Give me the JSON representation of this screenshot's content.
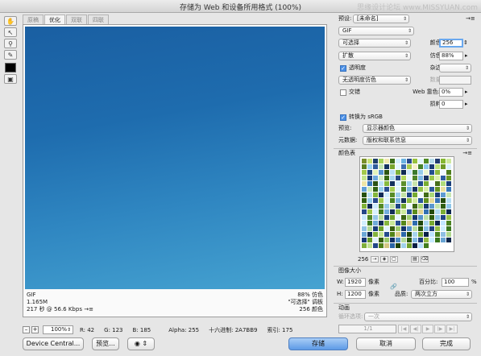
{
  "window": {
    "title": "存储为 Web 和设备所用格式 (100%)",
    "watermark": "思缘设计论坛 www.MISSYUAN.com"
  },
  "tools": [
    "hand-tool",
    "slice-select-tool",
    "zoom-tool",
    "eyedropper-tool"
  ],
  "tabs": [
    "原稿",
    "优化",
    "双联",
    "四联"
  ],
  "active_tab": "优化",
  "canvas_info": {
    "format": "GIF",
    "size": "1.165M",
    "time": "217 秒 @ 56.6 Kbps",
    "menu": "→≡",
    "dither_pct": "88% 仿色",
    "palette": "\"可选择\" 调板",
    "colors": "256 颜色"
  },
  "status": {
    "zoom_minus": "–",
    "zoom_plus": "+",
    "zoom": "100%",
    "r": "R: 42",
    "g": "G: 123",
    "b": "B: 185",
    "alpha": "Alpha: 255",
    "hex": "十六进制: 2A7BB9",
    "index": "索引: 175"
  },
  "buttons": {
    "device_central": "Device Central...",
    "preview": "预览...",
    "save": "存储",
    "cancel": "取消",
    "done": "完成"
  },
  "settings": {
    "preset_label": "预设:",
    "preset_value": "[未命名]",
    "format": "GIF",
    "reduction": "可选择",
    "dither_algo": "扩散",
    "transparency_label": "透明度",
    "matte_dither": "无透明度仿色",
    "interlaced_label": "交错",
    "colors_label": "颜色:",
    "colors_value": "256",
    "dither_label": "仿色:",
    "dither_value": "88%",
    "matte_label": "杂边:",
    "amount_label": "数量:",
    "web_snap_label": "Web 靠色:",
    "web_snap_value": "0%",
    "lossy_label": "损耗:",
    "lossy_value": "0",
    "convert_srgb_label": "转换为 sRGB",
    "preview_label": "预览:",
    "preview_value": "显示器颜色",
    "metadata_label": "元数据:",
    "metadata_value": "版权和联系信息"
  },
  "color_table": {
    "title": "颜色表",
    "count": "256",
    "swatches": [
      "#7a8f2a",
      "#c9e27a",
      "#1e3f6a",
      "#a4d25a",
      "#f2e8b0",
      "#3c6f1b",
      "#d6efff",
      "#6bb3e0",
      "#2a4c8c",
      "#98c23d",
      "#e0f4fa",
      "#4f8a24",
      "#b6dbea",
      "#213b6e",
      "#86b832",
      "#cfe9a0",
      "#5a7f1f",
      "#9ed4f2",
      "#2f5d9c",
      "#c2e5b4",
      "#153160",
      "#78a52e",
      "#e6f6ff",
      "#3d6fb0",
      "#a9cc4f",
      "#f6f0c8",
      "#46822a",
      "#8cc9ea",
      "#1b3a74",
      "#bfe27c",
      "#6e9a26",
      "#d9f0fb",
      "#a3c84a",
      "#1f467f",
      "#e3f2bc",
      "#5591cc",
      "#2c5510",
      "#b8e0f4",
      "#7cb23a",
      "#0f2a54",
      "#cde7ff",
      "#3b7a2e",
      "#96cdeb",
      "#e9f5d0",
      "#244f8f",
      "#8eba3c",
      "#f0faff",
      "#4d7d1c",
      "#c4e48c",
      "#163972",
      "#6fa9dc",
      "#d1ecc4",
      "#3a6b14",
      "#a7d8f0",
      "#284a86",
      "#b3d65e",
      "#e8f7ff",
      "#4f862a",
      "#82bde6",
      "#1a3562",
      "#9cc94c",
      "#ddf1aa",
      "#2e5ea0",
      "#6a9a22",
      "#efe6a6",
      "#3d7bc0",
      "#2b5215",
      "#bfe3f7",
      "#88bb3f",
      "#12305c",
      "#d7f0ff",
      "#5c8f2b",
      "#a2d3ee",
      "#c9e5ac",
      "#204a8a",
      "#7aae32",
      "#f3fbff",
      "#466f1a",
      "#b0dc7c",
      "#1b3f7a",
      "#61a0d6",
      "#cde9ba",
      "#336414",
      "#9ad0ee",
      "#2a4f90",
      "#a6cd54",
      "#e2f5ff",
      "#4a8426",
      "#7cb7e2",
      "#183460",
      "#93c248",
      "#d8efa4",
      "#2c5a9c",
      "#649421",
      "#ebe0a0",
      "#3877ba",
      "#26500f",
      "#bae0f5",
      "#84b63c",
      "#102c58",
      "#d2eeff",
      "#578c28",
      "#9ecfec",
      "#c3e2a6",
      "#1e4786",
      "#76aa30",
      "#f0f9ff",
      "#426c17",
      "#abd878",
      "#193d76",
      "#5e9cd2",
      "#c8e6b4",
      "#316112",
      "#95ccec",
      "#27498c",
      "#a2ca50",
      "#ddf3ff",
      "#468124",
      "#78b3df",
      "#16325c",
      "#8fbe44",
      "#d3eca0",
      "#2a5698",
      "#60901e",
      "#e6da9a",
      "#3573b6",
      "#244d0d",
      "#b5ddf3",
      "#80b238",
      "#0e2a54",
      "#cdebff",
      "#538926",
      "#9acbea",
      "#bddfa0",
      "#1c4382",
      "#72a62e",
      "#ecf7ff",
      "#3f6814",
      "#a6d474",
      "#173a72",
      "#5a98ce",
      "#c3e3ae",
      "#2e5e10",
      "#90c8ea",
      "#244688",
      "#9ec64c",
      "#d8f1ff",
      "#427e22",
      "#74afdc",
      "#142f58",
      "#8bba40",
      "#ceea9c",
      "#285294",
      "#5c8c1c",
      "#e2d494",
      "#3270b2",
      "#224a0c",
      "#b0daf1",
      "#7cae34",
      "#0c2750",
      "#c8e8ff",
      "#4f8624",
      "#96c7e8",
      "#b8dc9a",
      "#1a3f7e",
      "#6ea22c",
      "#e8f5ff",
      "#3c6412",
      "#a2d070",
      "#15366e",
      "#5694ca",
      "#bee0a8",
      "#2c5b0e",
      "#8cc4e8",
      "#214384",
      "#9ac248",
      "#d3efff",
      "#3e7a20",
      "#70abd9",
      "#122c54",
      "#87b63e",
      "#c9e898",
      "#264e90",
      "#58881a",
      "#ded08e",
      "#2f6cae",
      "#20470a",
      "#abd7ef",
      "#78aa32",
      "#0a244c",
      "#c3e6ff",
      "#4b8322",
      "#92c3e6",
      "#b3d994",
      "#183c7a",
      "#6a9e2a",
      "#e4f3ff",
      "#396010",
      "#9ecc6c",
      "#13336a",
      "#5290c6",
      "#b9dda2",
      "#2a580c",
      "#88c0e6",
      "#1f4080",
      "#96be44",
      "#ceedff",
      "#3a771e",
      "#6ca7d6",
      "#102950",
      "#83b23c",
      "#c4e594",
      "#244a8c",
      "#548418",
      "#d9cb88",
      "#2c68aa",
      "#1e4408",
      "#a6d4ed",
      "#74a630",
      "#082148",
      "#bee3ff",
      "#47801f",
      "#8ebfe4",
      "#aed68e",
      "#163876",
      "#669a28",
      "#e0f1ff",
      "#365d0e",
      "#9ac868",
      "#113066",
      "#4e8cc2",
      "#b4da9c",
      "#28550a",
      "#84bce4",
      "#1d3d7c",
      "#92ba40",
      "#c9ebff",
      "#36741c",
      "#68a3d3",
      "#0e264c",
      "#7fae3a",
      "#bfe290",
      "#224688",
      "#508016",
      "#d4c682",
      "#2964a6",
      "#1c4106",
      "#a1d1eb",
      "#70a22e",
      "#061e44",
      "#b9e0ff",
      "#437d1d"
    ]
  },
  "image_size": {
    "title": "图像大小",
    "w_label": "W:",
    "w_value": "1920",
    "h_label": "H:",
    "h_value": "1200",
    "unit": "像素",
    "percent_label": "百分比:",
    "percent_value": "100",
    "percent_sign": "%",
    "quality_label": "品质:",
    "quality_value": "两次立方"
  },
  "animation": {
    "title": "动画",
    "loop_label": "循环选项:",
    "loop_value": "一次",
    "frame": "1/1"
  }
}
